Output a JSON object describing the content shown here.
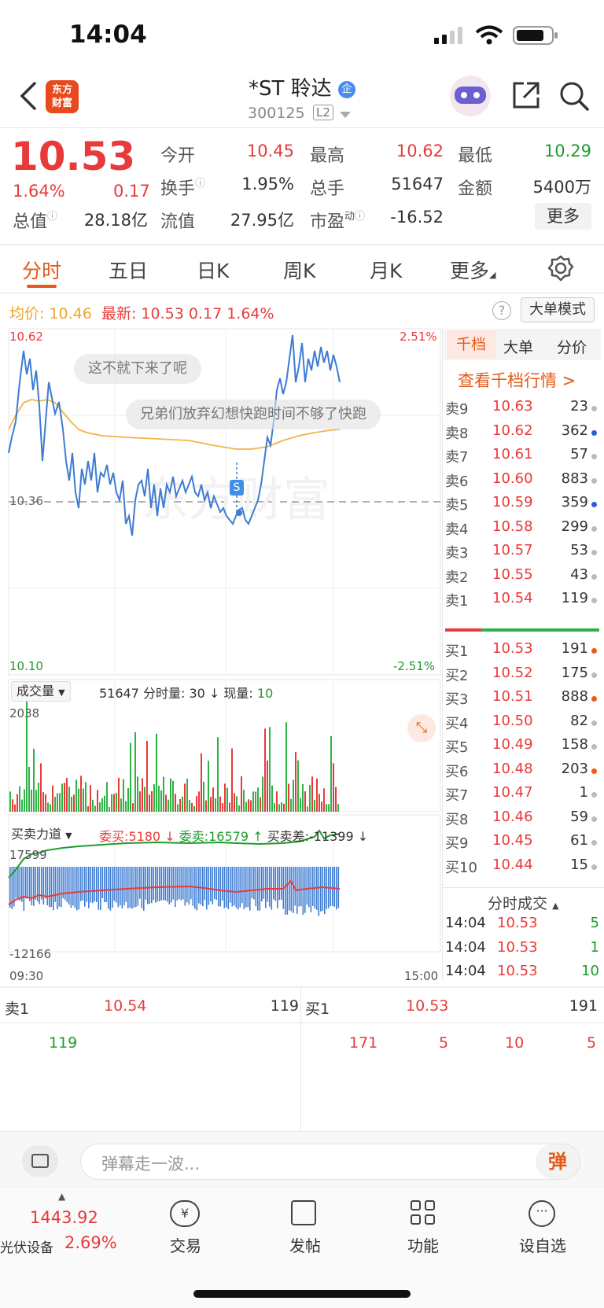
{
  "status": {
    "time": "14:04"
  },
  "header": {
    "logo_text": "东方财富",
    "name": "*ST 聆达",
    "code": "300125",
    "level": "L2"
  },
  "quote": {
    "price": "10.53",
    "pct": "1.64%",
    "chg": "0.17",
    "open_label": "今开",
    "open": "10.45",
    "high_label": "最高",
    "high": "10.62",
    "low_label": "最低",
    "low": "10.29",
    "turnover_label": "换手",
    "turnover": "1.95%",
    "volume_label": "总手",
    "volume": "51647",
    "amount_label": "金额",
    "amount": "5400万",
    "mktcap_label": "总值",
    "mktcap": "28.18亿",
    "float_label": "流值",
    "float": "27.95亿",
    "pe_label": "市盈",
    "pe_sup": "动",
    "pe": "-16.52",
    "more": "更多"
  },
  "tabs": [
    "分时",
    "五日",
    "日K",
    "周K",
    "月K",
    "更多"
  ],
  "summary": {
    "avg_label": "均价:",
    "avg": "10.46",
    "latest_label": "最新:",
    "latest": "10.53",
    "chg": "0.17",
    "pct": "1.64%",
    "mode_btn": "大单模式"
  },
  "chart": {
    "y_top": "10.62",
    "y_mid": "10.36",
    "y_bot": "10.10",
    "pct_top": "2.51%",
    "pct_bot": "-2.51%",
    "danmu1": "这不就下来了呢",
    "danmu2": "兄弟们放弃幻想快跑时间不够了快跑",
    "marker": "S",
    "vol_selector": "成交量",
    "vol_info": "51647 分时量: 30 ↓ 现量:",
    "vol_now": "10",
    "vol_max": "2038",
    "force_selector": "买卖力道",
    "wei_buy": "委买:5180 ↓",
    "wei_sell": "委卖:16579 ↑",
    "diff": "买卖差:-11399 ↓",
    "force_max": "17599",
    "force_min": "-12166",
    "time_start": "09:30",
    "time_end": "15:00"
  },
  "orderbook": {
    "tabs": [
      "千档",
      "大单",
      "分价"
    ],
    "link": "查看千档行情 >",
    "asks": [
      {
        "label": "卖9",
        "price": "10.63",
        "vol": "23",
        "dot": "#bbb"
      },
      {
        "label": "卖8",
        "price": "10.62",
        "vol": "362",
        "dot": "#2c5fd6"
      },
      {
        "label": "卖7",
        "price": "10.61",
        "vol": "57",
        "dot": "#bbb"
      },
      {
        "label": "卖6",
        "price": "10.60",
        "vol": "883",
        "dot": "#bbb"
      },
      {
        "label": "卖5",
        "price": "10.59",
        "vol": "359",
        "dot": "#2c5fd6"
      },
      {
        "label": "卖4",
        "price": "10.58",
        "vol": "299",
        "dot": "#bbb"
      },
      {
        "label": "卖3",
        "price": "10.57",
        "vol": "53",
        "dot": "#bbb"
      },
      {
        "label": "卖2",
        "price": "10.55",
        "vol": "43",
        "dot": "#bbb"
      },
      {
        "label": "卖1",
        "price": "10.54",
        "vol": "119",
        "dot": "#bbb"
      }
    ],
    "bids": [
      {
        "label": "买1",
        "price": "10.53",
        "vol": "191",
        "dot": "#ee5a16"
      },
      {
        "label": "买2",
        "price": "10.52",
        "vol": "175",
        "dot": "#bbb"
      },
      {
        "label": "买3",
        "price": "10.51",
        "vol": "888",
        "dot": "#ee5a16"
      },
      {
        "label": "买4",
        "price": "10.50",
        "vol": "82",
        "dot": "#bbb"
      },
      {
        "label": "买5",
        "price": "10.49",
        "vol": "158",
        "dot": "#bbb"
      },
      {
        "label": "买6",
        "price": "10.48",
        "vol": "203",
        "dot": "#ee5a16"
      },
      {
        "label": "买7",
        "price": "10.47",
        "vol": "1",
        "dot": "#bbb"
      },
      {
        "label": "买8",
        "price": "10.46",
        "vol": "59",
        "dot": "#bbb"
      },
      {
        "label": "买9",
        "price": "10.45",
        "vol": "61",
        "dot": "#bbb"
      },
      {
        "label": "买10",
        "price": "10.44",
        "vol": "15",
        "dot": "#bbb"
      }
    ],
    "trades_title": "分时成交",
    "trades": [
      {
        "time": "14:04",
        "price": "10.53",
        "vol": "5"
      },
      {
        "time": "14:04",
        "price": "10.53",
        "vol": "1"
      },
      {
        "time": "14:04",
        "price": "10.53",
        "vol": "10"
      }
    ]
  },
  "level1": {
    "sell_label": "卖1",
    "sell_price": "10.54",
    "sell_vol": "119",
    "buy_label": "买1",
    "buy_price": "10.53",
    "buy_vol": "191",
    "sell_queue": [
      "119"
    ],
    "buy_queue": [
      "171",
      "5",
      "10",
      "5"
    ]
  },
  "danmu_input": {
    "placeholder": "弹幕走一波...",
    "btn": "弹"
  },
  "bottom": {
    "index_value": "1443.92",
    "index_name": "光伏设备",
    "index_pct": "2.69%",
    "items": [
      "交易",
      "发帖",
      "功能",
      "设自选"
    ]
  }
}
